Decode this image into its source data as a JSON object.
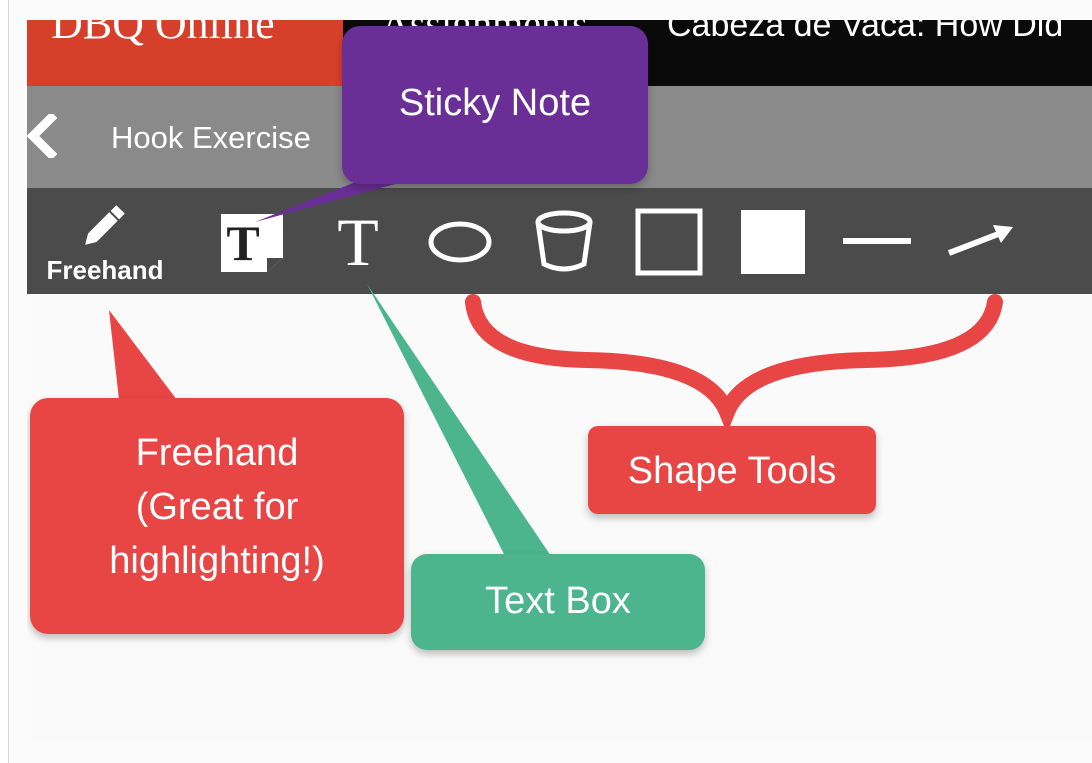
{
  "header": {
    "brand": "DBQ Online",
    "nav_assignments": "Assignments",
    "document_title": "Cabeza de Vaca: How Did"
  },
  "sub_bar": {
    "back_icon": "chevron-left-icon",
    "title": "Hook Exercise"
  },
  "toolbar": {
    "tools": [
      {
        "name": "freehand",
        "label": "Freehand",
        "icon": "pencil-icon"
      },
      {
        "name": "sticky-note",
        "icon": "sticky-note-icon"
      },
      {
        "name": "text-box",
        "icon": "text-icon",
        "glyph": "T"
      },
      {
        "name": "ellipse",
        "icon": "ellipse-icon"
      },
      {
        "name": "cylinder",
        "icon": "cylinder-icon"
      },
      {
        "name": "rectangle-outline",
        "icon": "rectangle-outline-icon"
      },
      {
        "name": "rectangle-filled",
        "icon": "rectangle-filled-icon"
      },
      {
        "name": "line",
        "icon": "line-icon"
      },
      {
        "name": "arrow",
        "icon": "arrow-icon"
      }
    ]
  },
  "callouts": {
    "sticky_note": "Sticky Note",
    "freehand_lines": [
      "Freehand",
      "(Great for",
      "highlighting!)"
    ],
    "text_box": "Text Box",
    "shape_tools": "Shape Tools"
  },
  "colors": {
    "brand_red": "#d6402b",
    "header_black": "#0a0a0a",
    "sub_bar_gray": "#8a8a8a",
    "toolbar_gray": "#4b4b4b",
    "callout_purple": "#6a2f96",
    "callout_red": "#e84545",
    "callout_green": "#4cb58e"
  }
}
